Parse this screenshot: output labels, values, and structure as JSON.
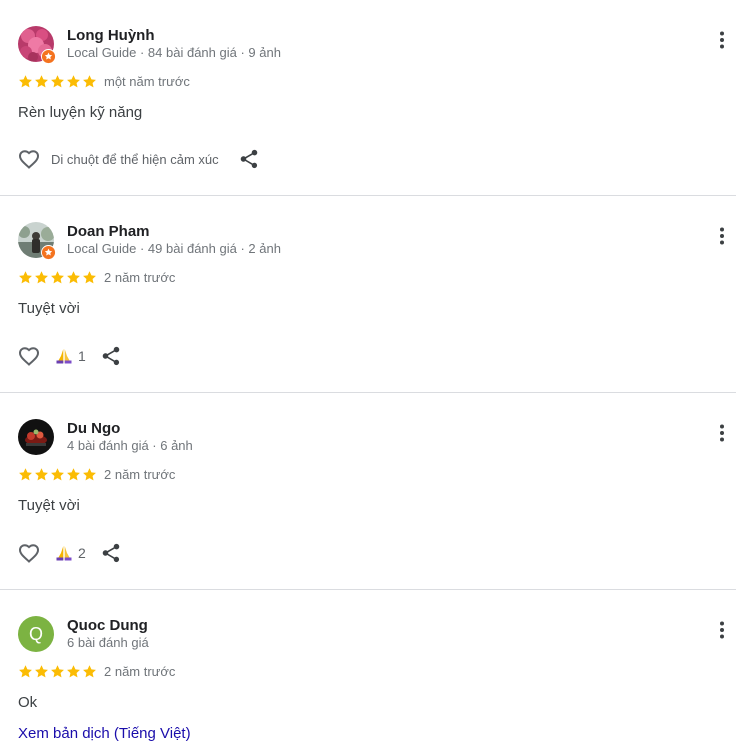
{
  "reviews": [
    {
      "name": "Long Huỳnh",
      "meta": "Local Guide · 84 bài đánh giá · 9 ảnh",
      "date": "một năm trước",
      "text": "Rèn luyện kỹ năng",
      "hover_text": "Di chuột để thể hiện cảm xúc",
      "rating": 5
    },
    {
      "name": "Doan Pham",
      "meta": "Local Guide · 49 bài đánh giá · 2 ảnh",
      "date": "2 năm trước",
      "text": "Tuyệt vời",
      "reaction_count": "1",
      "rating": 5
    },
    {
      "name": "Du Ngo",
      "meta": "4 bài đánh giá · 6 ảnh",
      "date": "2 năm trước",
      "text": "Tuyệt vời",
      "reaction_count": "2",
      "rating": 5
    },
    {
      "name": "Quoc Dung",
      "avatar_letter": "Q",
      "meta": "6 bài đánh giá",
      "date": "2 năm trước",
      "text": "Ok",
      "translate_link": "Xem bản dịch (Tiếng Việt)",
      "rating": 5
    }
  ],
  "colors": {
    "star": "#fbbc04",
    "guide_badge": "#f4731f",
    "avatar_letter_bg": "#7cb342",
    "link": "#1a0dab",
    "divider": "#dadce0"
  },
  "icons": {
    "more": "more-vert-icon",
    "like": "heart-outline-icon",
    "reaction": "folded-hands-emoji",
    "share": "share-icon",
    "star": "star-icon",
    "guide": "local-guide-badge-icon"
  }
}
